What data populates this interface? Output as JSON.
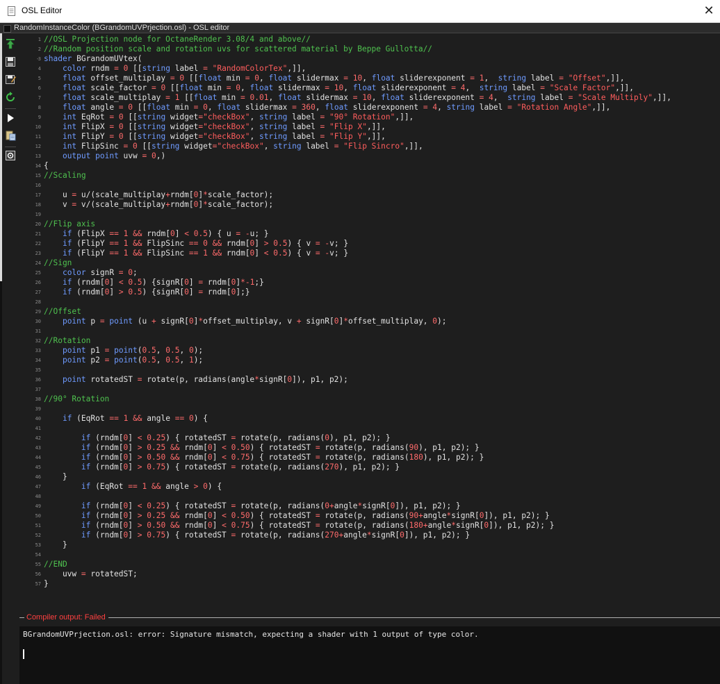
{
  "window": {
    "title": "OSL Editor",
    "close_glyph": "✕",
    "icon": "document-icon"
  },
  "document": {
    "title": "RandomInstanceColor (BGrandomUVPrjection.osl) - OSL editor"
  },
  "toolbar": {
    "items": [
      "upload-icon",
      "save-icon",
      "save-as-icon",
      "reload-icon",
      "run-icon",
      "paste-icon",
      "settings-icon"
    ]
  },
  "code": {
    "lines": [
      "//OSL Projection node for OctaneRender 3.08/4 and above//",
      "//Random position scale and rotation uvs for scattered material by Beppe Gullotta//",
      "shader BGrandomUVtex(",
      "    color rndm = 0 [[string label = \"RandomColorTex\",]],",
      "    float offset_multiplay = 0 [[float min = 0, float slidermax = 10, float sliderexponent = 1,  string label = \"Offset\",]],",
      "    float scale_factor = 0 [[float min = 0, float slidermax = 10, float sliderexponent = 4,  string label = \"Scale Factor\",]],",
      "    float scale_multiplay = 1 [[float min = 0.01, float slidermax = 10, float sliderexponent = 4,  string label = \"Scale Multiply\",]],",
      "    float angle = 0 [[float min = 0, float slidermax = 360, float sliderexponent = 4, string label = \"Rotation Angle\",]],",
      "    int EqRot = 0 [[string widget=\"checkBox\", string label = \"90° Rotation\",]],",
      "    int FlipX = 0 [[string widget=\"checkBox\", string label = \"Flip X\",]],",
      "    int FlipY = 0 [[string widget=\"checkBox\", string label = \"Flip Y\",]],",
      "    int FlipSinc = 0 [[string widget=\"checkBox\", string label = \"Flip Sincro\",]],",
      "    output point uvw = 0,)",
      "{",
      "//Scaling",
      "",
      "    u = u/(scale_multiplay+rndm[0]*scale_factor);",
      "    v = v/(scale_multiplay+rndm[0]*scale_factor);",
      "",
      "//Flip axis",
      "    if (FlipX == 1 && rndm[0] < 0.5) { u = -u; }",
      "    if (FlipY == 1 && FlipSinc == 0 && rndm[0] > 0.5) { v = -v; }",
      "    if (FlipY == 1 && FlipSinc == 1 && rndm[0] < 0.5) { v = -v; }",
      "//Sign",
      "    color signR = 0;",
      "    if (rndm[0] < 0.5) {signR[0] = rndm[0]*-1;}",
      "    if (rndm[0] > 0.5) {signR[0] = rndm[0];}",
      "",
      "//Offset",
      "    point p = point (u + signR[0]*offset_multiplay, v + signR[0]*offset_multiplay, 0);",
      "",
      "//Rotation",
      "    point p1 = point(0.5, 0.5, 0);",
      "    point p2 = point(0.5, 0.5, 1);",
      "",
      "    point rotatedST = rotate(p, radians(angle*signR[0]), p1, p2);",
      "",
      "//90° Rotation",
      "",
      "    if (EqRot == 1 && angle == 0) {",
      "",
      "        if (rndm[0] < 0.25) { rotatedST = rotate(p, radians(0), p1, p2); }",
      "        if (rndm[0] > 0.25 && rndm[0] < 0.50) { rotatedST = rotate(p, radians(90), p1, p2); }",
      "        if (rndm[0] > 0.50 && rndm[0] < 0.75) { rotatedST = rotate(p, radians(180), p1, p2); }",
      "        if (rndm[0] > 0.75) { rotatedST = rotate(p, radians(270), p1, p2); }",
      "    }",
      "        if (EqRot == 1 && angle > 0) {",
      "",
      "        if (rndm[0] < 0.25) { rotatedST = rotate(p, radians(0+angle*signR[0]), p1, p2); }",
      "        if (rndm[0] > 0.25 && rndm[0] < 0.50) { rotatedST = rotate(p, radians(90+angle*signR[0]), p1, p2); }",
      "        if (rndm[0] > 0.50 && rndm[0] < 0.75) { rotatedST = rotate(p, radians(180+angle*signR[0]), p1, p2); }",
      "        if (rndm[0] > 0.75) { rotatedST = rotate(p, radians(270+angle*signR[0]), p1, p2); }",
      "    }",
      "",
      "//END",
      "    uvw = rotatedST;",
      "}"
    ],
    "fold_markers": {
      "3": "-",
      "14": "-"
    }
  },
  "compiler": {
    "header": "Compiler output: Failed",
    "message": "BGrandomUVPrjection.osl: error: Signature mismatch, expecting a shader with 1 output of type color."
  },
  "colors": {
    "comment": "#4fc24f",
    "keyword": "#6f9bff",
    "string": "#ff5d5d",
    "number": "#ff6b6b",
    "text": "#e2e2e2",
    "error": "#ff4040"
  }
}
